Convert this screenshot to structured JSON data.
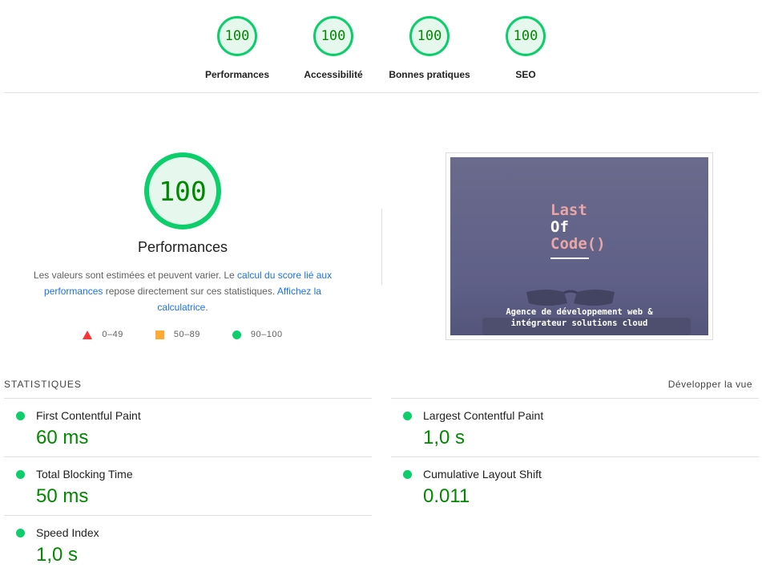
{
  "categories": [
    {
      "score": "100",
      "label": "Performances"
    },
    {
      "score": "100",
      "label": "Accessibilité"
    },
    {
      "score": "100",
      "label": "Bonnes pratiques"
    },
    {
      "score": "100",
      "label": "SEO"
    }
  ],
  "performance": {
    "score": "100",
    "title": "Performances",
    "desc_1": "Les valeurs sont estimées et peuvent varier. Le ",
    "link_1": "calcul du score lié aux performances",
    "desc_2": " repose directement sur ces statistiques. ",
    "link_2": "Affichez la calculatrice",
    "desc_3": "."
  },
  "legend": [
    {
      "icon": "triangle-icon",
      "range": "0–49",
      "color": "#ff3333"
    },
    {
      "icon": "square-icon",
      "range": "50–89",
      "color": "#ffaa33"
    },
    {
      "icon": "circle-icon",
      "range": "90–100",
      "color": "#0cce6b"
    }
  ],
  "screenshot": {
    "logo_line1": "Last",
    "logo_line2": "Of",
    "logo_line3": "Code()",
    "tagline_1": "Agence de développement web &",
    "tagline_2": "intégrateur solutions cloud"
  },
  "stats": {
    "title": "STATISTIQUES",
    "expand": "Développer la vue",
    "metrics": [
      {
        "name": "First Contentful Paint",
        "value": "60 ms"
      },
      {
        "name": "Largest Contentful Paint",
        "value": "1,0 s"
      },
      {
        "name": "Total Blocking Time",
        "value": "50 ms"
      },
      {
        "name": "Cumulative Layout Shift",
        "value": "0.011"
      },
      {
        "name": "Speed Index",
        "value": "1,0 s"
      }
    ]
  },
  "colors": {
    "pass": "#0cce6b",
    "pass_text": "#008800",
    "link": "#1a73e8"
  }
}
